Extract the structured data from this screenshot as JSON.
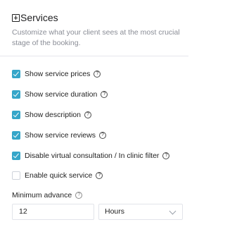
{
  "services": {
    "title": "Services",
    "subtitle": "Customize what your client sees at the most crucial stage of the booking."
  },
  "options": [
    {
      "label": "Show service prices",
      "checked": true
    },
    {
      "label": "Show service duration",
      "checked": true
    },
    {
      "label": "Show description",
      "checked": true
    },
    {
      "label": "Show service reviews",
      "checked": true
    },
    {
      "label": "Disable virtual consultation / In clinic filter",
      "checked": true
    },
    {
      "label": "Enable quick service",
      "checked": false
    }
  ],
  "minimum_advance": {
    "label": "Minimum advance",
    "value": "12",
    "unit": "Hours"
  },
  "help_glyph": "?",
  "colors": {
    "accent": "#35a6c9",
    "muted_text": "#8a8d96",
    "border": "#e2e4ea"
  }
}
